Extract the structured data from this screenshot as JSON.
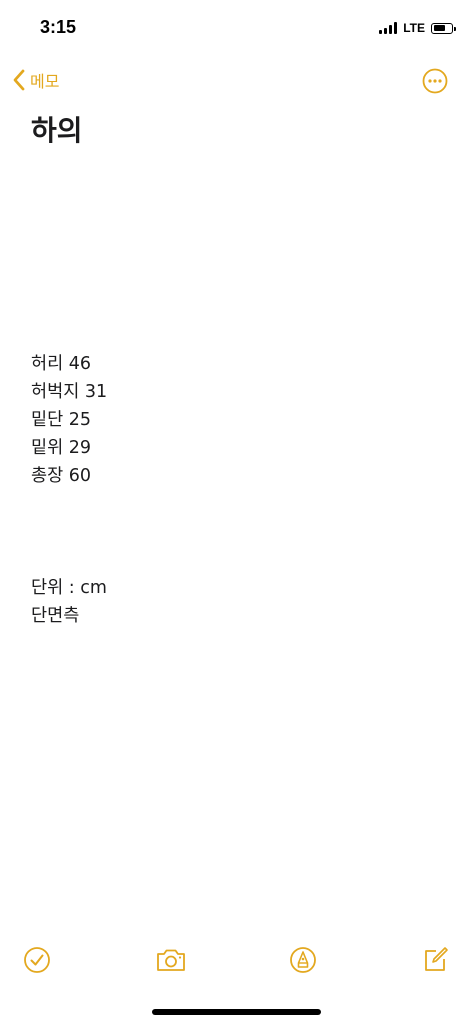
{
  "status_bar": {
    "time": "3:15",
    "network": "LTE",
    "signal_bars": 4,
    "battery_level": 0.7
  },
  "nav": {
    "back_label": "메모",
    "back_icon": "chevron-left-icon",
    "more_icon": "ellipsis-circle-icon"
  },
  "note": {
    "title": "하의",
    "lines": [
      "허리 46",
      "허벅지 31",
      "밑단 25",
      "밑위 29",
      "총장 60",
      "",
      "",
      "",
      "단위 : cm",
      "단면측"
    ]
  },
  "toolbar": {
    "checklist_icon": "checkmark-circle-icon",
    "camera_icon": "camera-icon",
    "markup_icon": "pen-tip-circle-icon",
    "compose_icon": "compose-icon"
  },
  "colors": {
    "accent": "#e3a81f",
    "text": "#1c1c1e",
    "background": "#ffffff"
  }
}
